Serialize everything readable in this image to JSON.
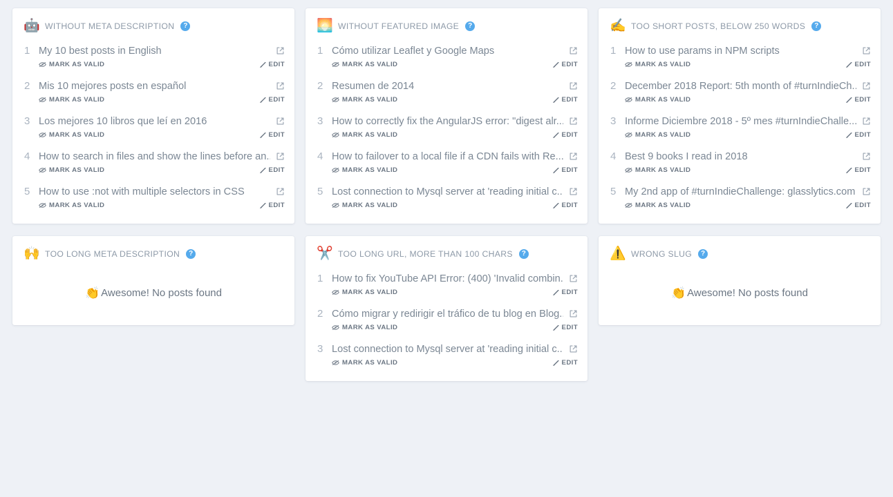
{
  "theme": {
    "page_background": "#eef1f6",
    "card_background": "#ffffff",
    "title_color": "#8e9aa8",
    "post_title_color": "#7b8794",
    "help_icon_color": "#55aaec",
    "index_color": "#aab4c0"
  },
  "labels": {
    "mark_as_valid": "MARK AS VALID",
    "edit": "EDIT",
    "help": "?",
    "empty_message": "Awesome! No posts found",
    "empty_emoji": "👏"
  },
  "cards": [
    {
      "id": "without-meta-description",
      "emoji": "🤖",
      "emoji_name": "robot-emoji",
      "title": "WITHOUT META DESCRIPTION",
      "empty": false,
      "posts": [
        {
          "index": "1",
          "title": "My 10 best posts in English"
        },
        {
          "index": "2",
          "title": "Mis 10 mejores posts en español"
        },
        {
          "index": "3",
          "title": "Los mejores 10 libros que leí en 2016"
        },
        {
          "index": "4",
          "title": "How to search in files and show the lines before an..."
        },
        {
          "index": "5",
          "title": "How to use :not with multiple selectors in CSS"
        }
      ]
    },
    {
      "id": "without-featured-image",
      "emoji": "🌅",
      "emoji_name": "framed-picture-emoji",
      "title": "WITHOUT FEATURED IMAGE",
      "empty": false,
      "posts": [
        {
          "index": "1",
          "title": "Cómo utilizar Leaflet y Google Maps"
        },
        {
          "index": "2",
          "title": "Resumen de 2014"
        },
        {
          "index": "3",
          "title": "How to correctly fix the AngularJS error: \"digest alr..."
        },
        {
          "index": "4",
          "title": "How to failover to a local file if a CDN fails with Re..."
        },
        {
          "index": "5",
          "title": "Lost connection to Mysql server at 'reading initial c..."
        }
      ]
    },
    {
      "id": "too-short-posts",
      "emoji": "✍️",
      "emoji_name": "writing-hand-emoji",
      "title": "TOO SHORT POSTS, BELOW 250 WORDS",
      "empty": false,
      "posts": [
        {
          "index": "1",
          "title": "How to use params in NPM scripts"
        },
        {
          "index": "2",
          "title": "December 2018 Report: 5th month of #turnIndieCh..."
        },
        {
          "index": "3",
          "title": "Informe Diciembre 2018 - 5º mes #turnIndieChalle..."
        },
        {
          "index": "4",
          "title": "Best 9 books I read in 2018"
        },
        {
          "index": "5",
          "title": "My 2nd app of #turnIndieChallenge: glasslytics.com"
        }
      ]
    },
    {
      "id": "too-long-meta-description",
      "emoji": "🙌",
      "emoji_name": "raising-hands-emoji",
      "title": "TOO LONG META DESCRIPTION",
      "empty": true,
      "posts": []
    },
    {
      "id": "too-long-url",
      "emoji": "✂️",
      "emoji_name": "scissors-emoji",
      "title": "TOO LONG URL, MORE THAN 100 CHARS",
      "empty": false,
      "posts": [
        {
          "index": "1",
          "title": "How to fix YouTube API Error: (400) 'Invalid combin..."
        },
        {
          "index": "2",
          "title": "Cómo migrar y redirigir el tráfico de tu blog en Blog..."
        },
        {
          "index": "3",
          "title": "Lost connection to Mysql server at 'reading initial c..."
        }
      ]
    },
    {
      "id": "wrong-slug",
      "emoji": "⚠️",
      "emoji_name": "warning-emoji",
      "title": "WRONG SLUG",
      "empty": true,
      "posts": []
    }
  ]
}
